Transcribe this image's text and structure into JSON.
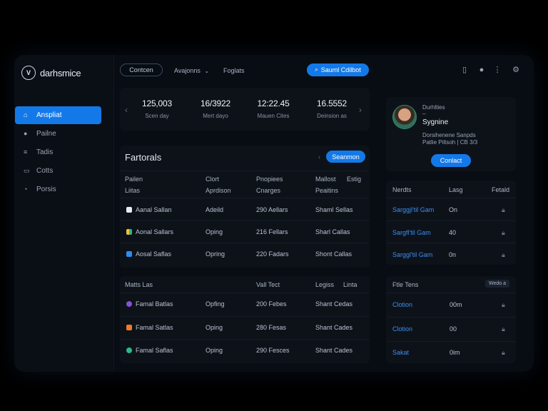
{
  "app": {
    "name": "darhsmice",
    "logo_letter": "V"
  },
  "sidebar": {
    "items": [
      {
        "label": "Anspliat",
        "icon": "home-icon",
        "active": true
      },
      {
        "label": "Pailne",
        "icon": "user-icon",
        "active": false
      },
      {
        "label": "Tadis",
        "icon": "list-icon",
        "active": false
      },
      {
        "label": "Cotts",
        "icon": "card-icon",
        "active": false
      },
      {
        "label": "Porsis",
        "icon": "clock-icon",
        "active": false
      }
    ]
  },
  "topbar": {
    "content_btn": "Contcen",
    "dropdown_label": "Avajonns",
    "link": "Foglats",
    "cta_btn": "Sauml Cdilbot",
    "icons": [
      "tablet-icon",
      "help-icon",
      "more-icon",
      "settings-icon"
    ]
  },
  "stats": [
    {
      "value": "125,003",
      "label": "Scen day"
    },
    {
      "value": "16/3922",
      "label": "Mert dayo"
    },
    {
      "value": "12:22.45",
      "label": "Mauen Cites"
    },
    {
      "value": "16.5552",
      "label": "Deinsion as"
    }
  ],
  "profile": {
    "line1": "Durhlties",
    "line2": "–",
    "name": "Sygnine",
    "detail1": "Dorsihenene Sanpds",
    "detail2": "Patlie Piltsoh | CB 3/3",
    "button": "Conlact"
  },
  "table1": {
    "title": "Fartorals",
    "button": "Seanmon",
    "headers": [
      {
        "top": "Pailen",
        "bottom": "Liitas"
      },
      {
        "top": "Clort",
        "bottom": "Aprdison"
      },
      {
        "top": "Pnopiees",
        "bottom": "Cnarges"
      },
      {
        "top": "Mallost",
        "bottom": "Peaitins"
      },
      {
        "top": "Estig",
        "bottom": ""
      }
    ],
    "rows": [
      {
        "name": "Aanal Sallan",
        "c2": "Adeild",
        "c3": "290 Aellars",
        "c4": "Shaml Sellas",
        "icon_color": "#e8ecf2"
      },
      {
        "name": "Aonal Sallars",
        "c2": "Oping",
        "c3": "216 Fellars",
        "c4": "Sharl Callas",
        "icon_color": "#f2c230"
      },
      {
        "name": "Aosal Saflas",
        "c2": "Opring",
        "c3": "220 Fadars",
        "c4": "Shont Callas",
        "icon_color": "#2a8ef2"
      }
    ]
  },
  "table2": {
    "headers": [
      "Matts Las",
      "Vall Tect",
      "Legiss",
      "Linta"
    ],
    "rows": [
      {
        "name": "Famal Batlas",
        "c2": "Opfing",
        "c3": "200 Febes",
        "c4": "Shant Cedas",
        "icon_color": "#8a4fd8"
      },
      {
        "name": "Famal Satlas",
        "c2": "Oping",
        "c3": "280 Fesas",
        "c4": "Shant Cades",
        "icon_color": "#f07a2a"
      },
      {
        "name": "Famal Saflas",
        "c2": "Oping",
        "c3": "290 Fesces",
        "c4": "Shant Cades",
        "icon_color": "#2ab88a"
      }
    ]
  },
  "side1": {
    "headers": [
      "Nerdts",
      "Lasg",
      "Fetald"
    ],
    "rows": [
      {
        "name": "Sarggjl'til Gam",
        "val": "On"
      },
      {
        "name": "Sargfl'til Gam",
        "val": "40"
      },
      {
        "name": "Sarggl'til Gam",
        "val": "0n"
      }
    ]
  },
  "side2": {
    "title": "Ftle Tens",
    "badge": "Wedo a",
    "rows": [
      {
        "name": "Clotion",
        "val": "00m"
      },
      {
        "name": "Clotion",
        "val": "00"
      },
      {
        "name": "Sakat",
        "val": "0im"
      }
    ]
  }
}
